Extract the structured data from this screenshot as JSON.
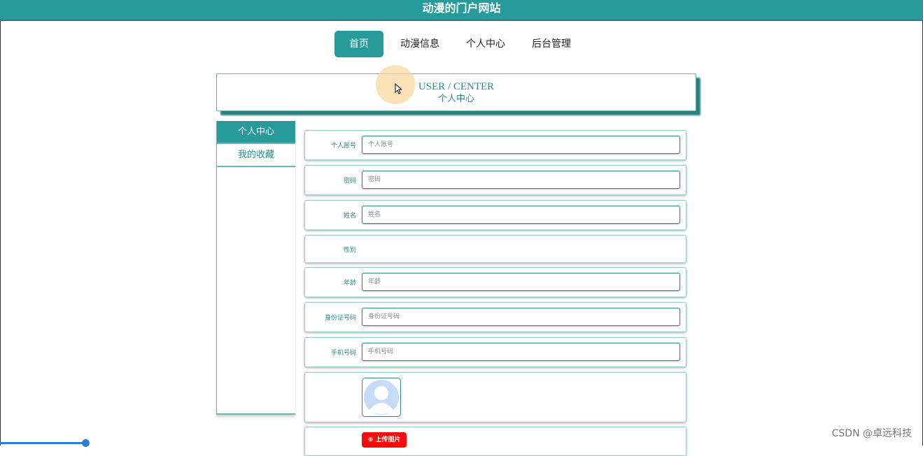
{
  "header": {
    "site_title": "动漫的门户网站"
  },
  "nav": {
    "items": [
      {
        "label": "首页",
        "active": true
      },
      {
        "label": "动漫信息",
        "active": false
      },
      {
        "label": "个人中心",
        "active": false
      },
      {
        "label": "后台管理",
        "active": false
      }
    ]
  },
  "banner": {
    "english": "USER / CENTER",
    "chinese": "个人中心"
  },
  "sidebar": {
    "items": [
      {
        "label": "个人中心",
        "active": true
      },
      {
        "label": "我的收藏",
        "active": false
      }
    ]
  },
  "form": {
    "account": {
      "label": "个人账号",
      "placeholder": "个人账号"
    },
    "password": {
      "label": "密码",
      "placeholder": "密码"
    },
    "name": {
      "label": "姓名",
      "placeholder": "姓名"
    },
    "gender": {
      "label": "性别"
    },
    "age": {
      "label": "年龄",
      "placeholder": "年龄"
    },
    "id_number": {
      "label": "身份证号码",
      "placeholder": "身份证号码"
    },
    "phone": {
      "label": "手机号码",
      "placeholder": "手机号码"
    },
    "upload_label": "上传图片"
  },
  "watermark": "CSDN @卓远科技",
  "colors": {
    "primary": "#279a9c",
    "text_accent": "#2a8a8c",
    "upload_button": "#f50d0d"
  }
}
